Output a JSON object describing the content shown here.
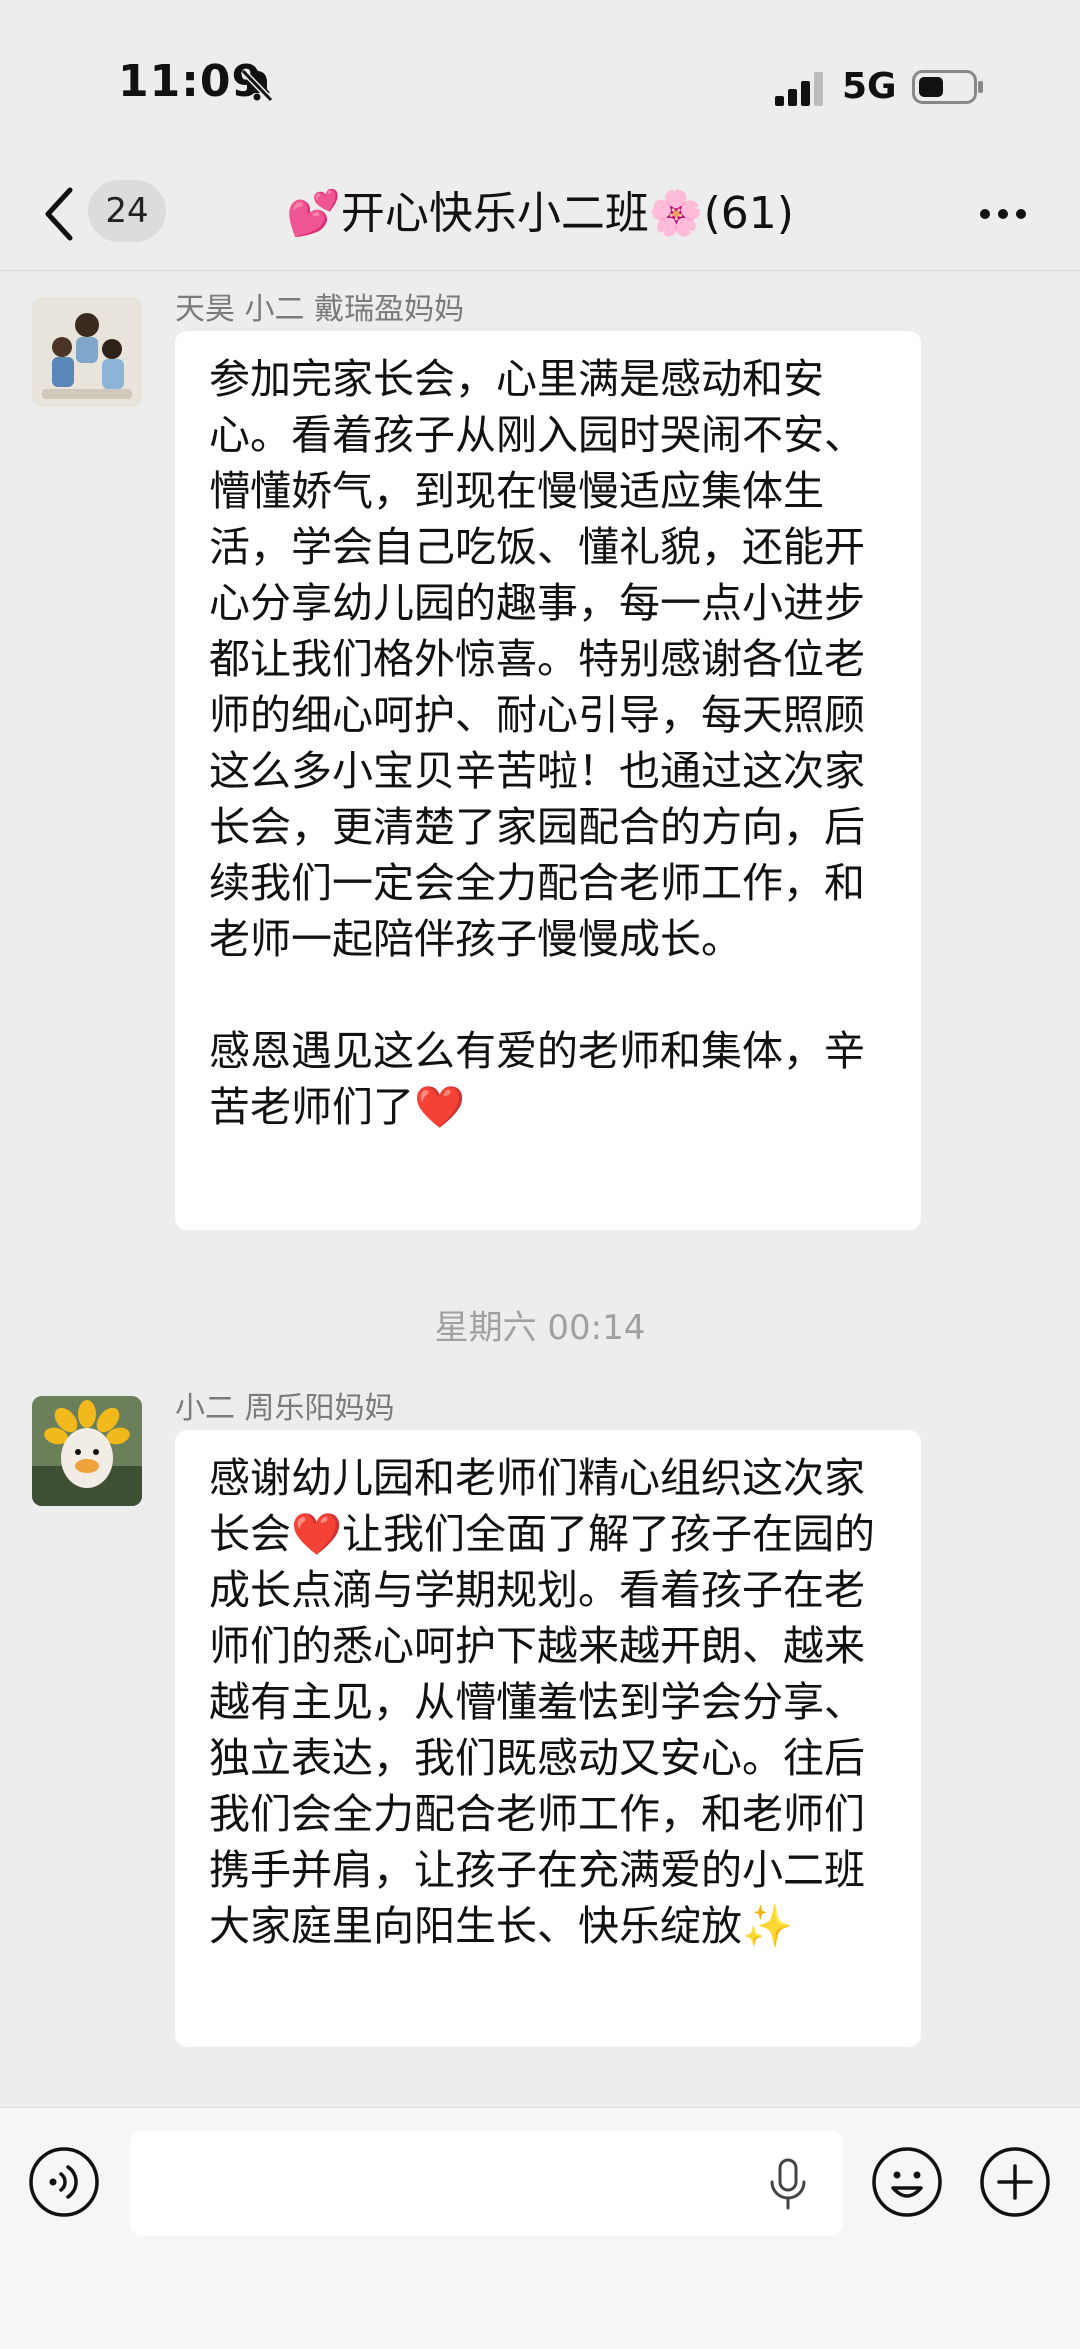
{
  "status_bar": {
    "time": "11:09",
    "network": "5G"
  },
  "nav": {
    "unread_count": "24",
    "title": "💕开心快乐小二班🌸(61)"
  },
  "messages": [
    {
      "sender": "天昊 小二 戴瑞盈妈妈",
      "text": "参加完家长会，心里满是感动和安心。看着孩子从刚入园时哭闹不安、懵懂娇气，到现在慢慢适应集体生活，学会自己吃饭、懂礼貌，还能开心分享幼儿园的趣事，每一点小进步都让我们格外惊喜。特别感谢各位老师的细心呵护、耐心引导，每天照顾这么多小宝贝辛苦啦！也通过这次家长会，更清楚了家园配合的方向，后续我们一定会全力配合老师工作，和老师一起陪伴孩子慢慢成长。\n\n感恩遇见这么有爱的老师和集体，辛苦老师们了❤️"
    },
    {
      "sender": "小二 周乐阳妈妈",
      "text": "感谢幼儿园和老师们精心组织这次家长会❤️让我们全面了解了孩子在园的成长点滴与学期规划。看着孩子在老师们的悉心呵护下越来越开朗、越来越有主见，从懵懂羞怯到学会分享、独立表达，我们既感动又安心。往后我们会全力配合老师工作，和老师们携手并肩，让孩子在充满爱的小二班大家庭里向阳生长、快乐绽放✨"
    }
  ],
  "timestamp": "星期六 00:14",
  "icons": {
    "back": "chevron-left-icon",
    "more": "more-dots-icon",
    "voice": "voice-input-icon",
    "mic": "microphone-icon",
    "emoji": "emoji-icon",
    "plus": "plus-icon",
    "mute": "bell-slash-icon"
  },
  "colors": {
    "background": "#ededed",
    "bubble": "#ffffff",
    "badge": "#dcdcdc"
  }
}
